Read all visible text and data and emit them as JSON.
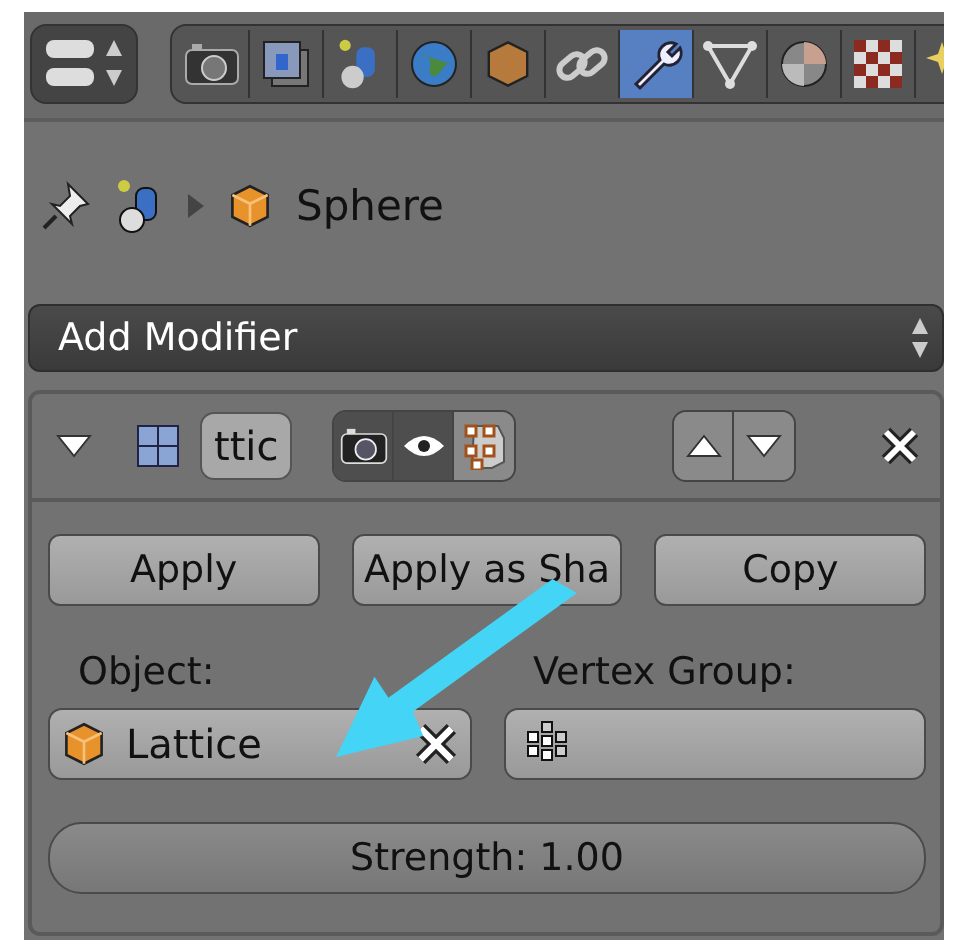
{
  "header": {
    "tabs": [
      {
        "kind": "camera",
        "selected": false
      },
      {
        "kind": "layers",
        "selected": false
      },
      {
        "kind": "scene",
        "selected": false
      },
      {
        "kind": "world",
        "selected": false
      },
      {
        "kind": "object",
        "selected": false
      },
      {
        "kind": "constraints",
        "selected": false
      },
      {
        "kind": "modifiers",
        "selected": true
      },
      {
        "kind": "data",
        "selected": false
      },
      {
        "kind": "material",
        "selected": false
      },
      {
        "kind": "texture",
        "selected": false
      },
      {
        "kind": "particles",
        "selected": false
      }
    ]
  },
  "breadcrumb": {
    "object": "Sphere"
  },
  "add_modifier": {
    "label": "Add Modifier"
  },
  "modifier": {
    "expanded": true,
    "name": "ttic",
    "toggles": [
      {
        "kind": "render",
        "on": true
      },
      {
        "kind": "viewport",
        "on": true
      },
      {
        "kind": "editmode",
        "on": false
      }
    ],
    "buttons": [
      "Apply",
      "Apply as Sha",
      "Copy"
    ],
    "object_label": "Object:",
    "object_value": "Lattice",
    "vertex_group_label": "Vertex Group:",
    "strength": "Strength: 1.00"
  }
}
